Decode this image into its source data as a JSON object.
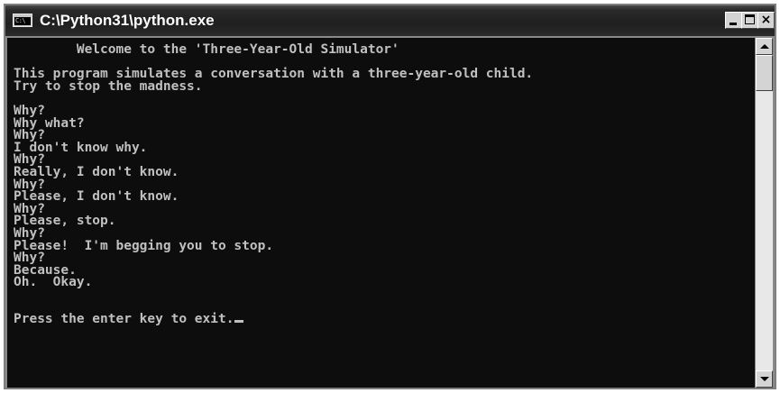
{
  "window": {
    "title": "C:\\Python31\\python.exe",
    "icon": "console-icon",
    "icon_text": "C:\\",
    "buttons": {
      "minimize": "minimize-icon",
      "maximize": "maximize-icon",
      "close_label": "×"
    }
  },
  "console": {
    "lines": [
      "        Welcome to the 'Three-Year-Old Simulator'",
      "",
      "This program simulates a conversation with a three-year-old child.",
      "Try to stop the madness.",
      "",
      "Why?",
      "Why what?",
      "Why?",
      "I don't know why.",
      "Why?",
      "Really, I don't know.",
      "Why?",
      "Please, I don't know.",
      "Why?",
      "Please, stop.",
      "Why?",
      "Please!  I'm begging you to stop.",
      "Why?",
      "Because.",
      "Oh.  Okay.",
      "",
      "",
      "Press the enter key to exit."
    ],
    "text_color": "#c0c0c0",
    "background_color": "#0d0d0d"
  },
  "scrollbar": {
    "up_icon": "arrow-up-icon",
    "down_icon": "arrow-down-icon"
  }
}
